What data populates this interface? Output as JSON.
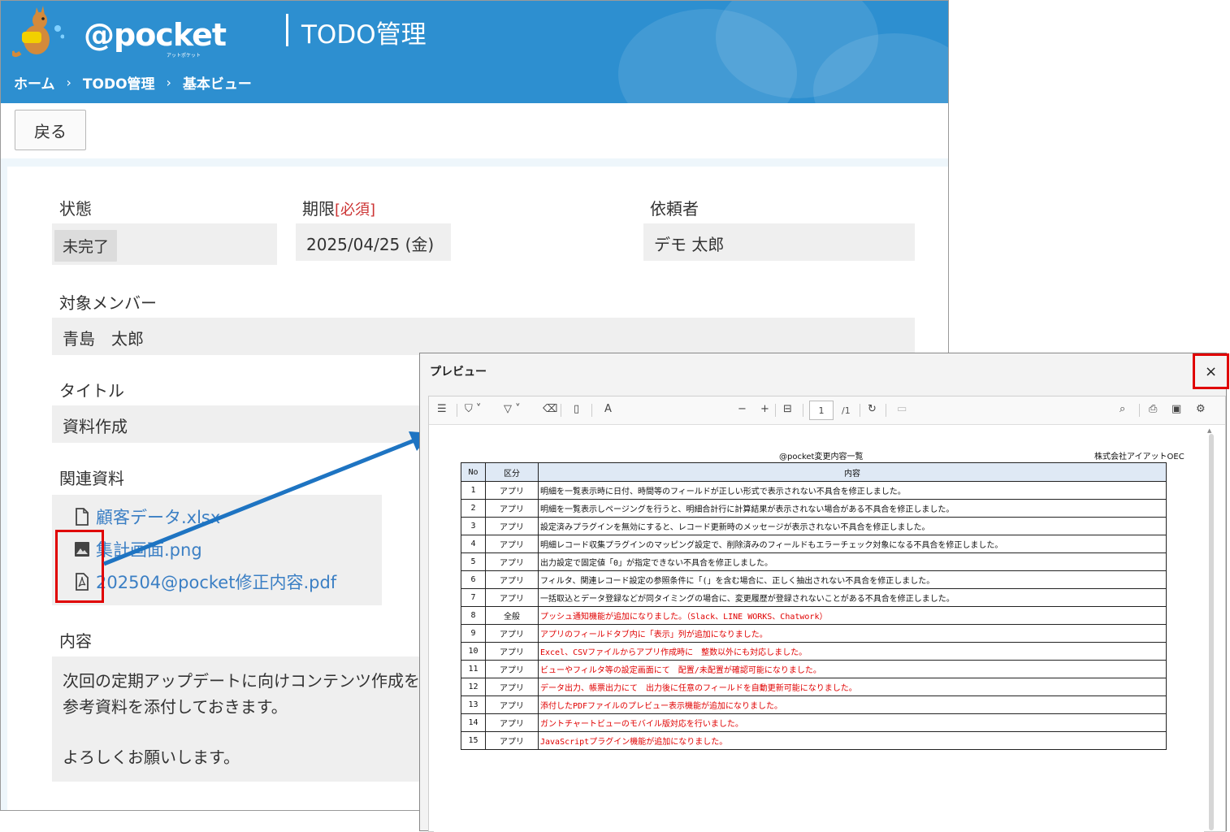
{
  "header": {
    "brand": "@pocket",
    "brand_sub": "アットポケット",
    "app_title": "TODO管理",
    "breadcrumb": [
      "ホーム",
      "TODO管理",
      "基本ビュー"
    ],
    "breadcrumb_sep": "›"
  },
  "toolbar": {
    "back_label": "戻る"
  },
  "form": {
    "status": {
      "label": "状態",
      "value": "未完了"
    },
    "deadline": {
      "label": "期限",
      "required": "[必須]",
      "value": "2025/04/25 (金)"
    },
    "requester": {
      "label": "依頼者",
      "value": "デモ 太郎"
    },
    "members": {
      "label": "対象メンバー",
      "value": "青島　太郎"
    },
    "title": {
      "label": "タイトル",
      "value": "資料作成"
    },
    "attachments": {
      "label": "関連資料",
      "files": [
        {
          "name": "顧客データ.xlsx",
          "icon": "file-icon"
        },
        {
          "name": "集計画面.png",
          "icon": "image-icon"
        },
        {
          "name": "202504@pocket修正内容.pdf",
          "icon": "pdf-icon"
        }
      ]
    },
    "content": {
      "label": "内容",
      "line1": "次回の定期アップデートに向けコンテンツ作成を",
      "line2": "参考資料を添付しておきます。",
      "line3": "よろしくお願いします。"
    }
  },
  "preview": {
    "title": "プレビュー",
    "close": "×",
    "toolbar": {
      "page_current": "1",
      "page_total": "/1"
    },
    "doc_title": "@pocket変更内容一覧",
    "company": "株式会社アイアットOEC",
    "table_headers": [
      "No",
      "区分",
      "内容"
    ],
    "rows": [
      {
        "no": "1",
        "cat": "アプリ",
        "desc": "明細を一覧表示時に日付、時間等のフィールドが正しい形式で表示されない不具合を修正しました。",
        "highlight": false
      },
      {
        "no": "2",
        "cat": "アプリ",
        "desc": "明細を一覧表示しページングを行うと、明細合計行に計算結果が表示されない場合がある不具合を修正しました。",
        "highlight": false
      },
      {
        "no": "3",
        "cat": "アプリ",
        "desc": "設定済みプラグインを無効にすると、レコード更新時のメッセージが表示されない不具合を修正しました。",
        "highlight": false
      },
      {
        "no": "4",
        "cat": "アプリ",
        "desc": "明細レコード収集プラグインのマッピング設定で、削除済みのフィールドもエラーチェック対象になる不具合を修正しました。",
        "highlight": false
      },
      {
        "no": "5",
        "cat": "アプリ",
        "desc": "出力設定で固定値「0」が指定できない不具合を修正しました。",
        "highlight": false
      },
      {
        "no": "6",
        "cat": "アプリ",
        "desc": "フィルタ、関連レコード設定の参照条件に「(」を含む場合に、正しく抽出されない不具合を修正しました。",
        "highlight": false
      },
      {
        "no": "7",
        "cat": "アプリ",
        "desc": "一括取込とデータ登録などが同タイミングの場合に、変更履歴が登録されないことがある不具合を修正しました。",
        "highlight": false
      },
      {
        "no": "8",
        "cat": "全般",
        "desc": "プッシュ通知機能が追加になりました。（Slack、LINE WORKS、Chatwork）",
        "highlight": true
      },
      {
        "no": "9",
        "cat": "アプリ",
        "desc": "アプリのフィールドタブ内に「表示」列が追加になりました。",
        "highlight": true
      },
      {
        "no": "10",
        "cat": "アプリ",
        "desc": "Excel、CSVファイルからアプリ作成時に　整数以外にも対応しました。",
        "highlight": true
      },
      {
        "no": "11",
        "cat": "アプリ",
        "desc": "ビューやフィルタ等の設定画面にて　配置/未配置が確認可能になりました。",
        "highlight": true
      },
      {
        "no": "12",
        "cat": "アプリ",
        "desc": "データ出力、帳票出力にて　出力後に任意のフィールドを自動更新可能になりました。",
        "highlight": true
      },
      {
        "no": "13",
        "cat": "アプリ",
        "desc": "添付したPDFファイルのプレビュー表示機能が追加になりました。",
        "highlight": true
      },
      {
        "no": "14",
        "cat": "アプリ",
        "desc": "ガントチャートビューのモバイル版対応を行いました。",
        "highlight": true
      },
      {
        "no": "15",
        "cat": "アプリ",
        "desc": "JavaScriptプラグイン機能が追加になりました。",
        "highlight": true
      }
    ]
  },
  "colors": {
    "header_blue": "#2d8fd0",
    "link_blue": "#3b7fc4",
    "highlight_red": "#e00000",
    "arrow_blue": "#1e74c2"
  }
}
